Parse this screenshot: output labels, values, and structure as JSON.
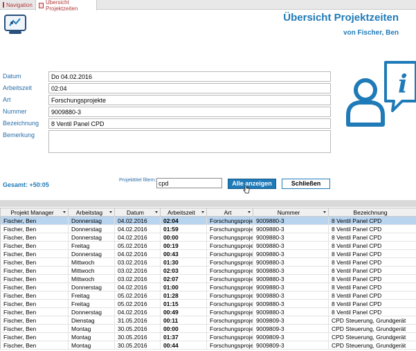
{
  "tabs": [
    {
      "label": "Navigation"
    },
    {
      "label": "Übersicht Projektzeiten"
    }
  ],
  "header": {
    "title": "Übersicht Projektzeiten",
    "subtitle": "von Fischer, Ben"
  },
  "form": {
    "datum_label": "Datum",
    "datum_value": "Do 04.02.2016",
    "arbeitszeit_label": "Arbeitszeit",
    "arbeitszeit_value": "02:04",
    "art_label": "Art",
    "art_value": "Forschungsprojekte",
    "nummer_label": "Nummer",
    "nummer_value": "9009880-3",
    "bezeichnung_label": "Bezeichnung",
    "bezeichnung_value": "8 Ventil Panel CPD",
    "bemerkung_label": "Bemerkung",
    "bemerkung_value": ""
  },
  "summary": {
    "gesamt": "Gesamt:  +50:05"
  },
  "filter": {
    "label": "Projekttitel filtern:",
    "value": "cpd"
  },
  "buttons": {
    "alle": "Alle anzeigen",
    "schliessen": "Schließen"
  },
  "table": {
    "columns": [
      "Projekt Manager",
      "Arbeitstag",
      "Datum",
      "Arbeitszeit",
      "Art",
      "Nummer",
      "Bezeichnung"
    ],
    "rows": [
      [
        "Fischer, Ben",
        "Donnerstag",
        "04.02.2016",
        "02:04",
        "Forschungsproje",
        "9009880-3",
        "8 Ventil Panel CPD"
      ],
      [
        "Fischer, Ben",
        "Donnerstag",
        "04.02.2016",
        "01:59",
        "Forschungsproje",
        "9009880-3",
        "8 Ventil Panel CPD"
      ],
      [
        "Fischer, Ben",
        "Donnerstag",
        "04.02.2016",
        "00:00",
        "Forschungsproje",
        "9009880-3",
        "8 Ventil Panel CPD"
      ],
      [
        "Fischer, Ben",
        "Freitag",
        "05.02.2016",
        "00:19",
        "Forschungsproje",
        "9009880-3",
        "8 Ventil Panel CPD"
      ],
      [
        "Fischer, Ben",
        "Donnerstag",
        "04.02.2016",
        "00:43",
        "Forschungsproje",
        "9009880-3",
        "8 Ventil Panel CPD"
      ],
      [
        "Fischer, Ben",
        "Mittwoch",
        "03.02.2016",
        "01:30",
        "Forschungsproje",
        "9009880-3",
        "8 Ventil Panel CPD"
      ],
      [
        "Fischer, Ben",
        "Mittwoch",
        "03.02.2016",
        "02:03",
        "Forschungsproje",
        "9009880-3",
        "8 Ventil Panel CPD"
      ],
      [
        "Fischer, Ben",
        "Mittwoch",
        "03.02.2016",
        "02:07",
        "Forschungsproje",
        "9009880-3",
        "8 Ventil Panel CPD"
      ],
      [
        "Fischer, Ben",
        "Donnerstag",
        "04.02.2016",
        "01:00",
        "Forschungsproje",
        "9009880-3",
        "8 Ventil Panel CPD"
      ],
      [
        "Fischer, Ben",
        "Freitag",
        "05.02.2016",
        "01:28",
        "Forschungsproje",
        "9009880-3",
        "8 Ventil Panel CPD"
      ],
      [
        "Fischer, Ben",
        "Freitag",
        "05.02.2016",
        "01:15",
        "Forschungsproje",
        "9009880-3",
        "8 Ventil Panel CPD"
      ],
      [
        "Fischer, Ben",
        "Donnerstag",
        "04.02.2016",
        "00:49",
        "Forschungsproje",
        "9009880-3",
        "8 Ventil Panel CPD"
      ],
      [
        "Fischer, Ben",
        "Dienstag",
        "31.05.2016",
        "00:11",
        "Forschungsproje",
        "9009809-3",
        "CPD Steuerung, Grundgerät"
      ],
      [
        "Fischer, Ben",
        "Montag",
        "30.05.2016",
        "00:00",
        "Forschungsproje",
        "9009809-3",
        "CPD Steuerung, Grundgerät"
      ],
      [
        "Fischer, Ben",
        "Montag",
        "30.05.2016",
        "01:37",
        "Forschungsproje",
        "9009809-3",
        "CPD Steuerung, Grundgerät"
      ],
      [
        "Fischer, Ben",
        "Montag",
        "30.05.2016",
        "00:44",
        "Forschungsproje",
        "9009809-3",
        "CPD Steuerung, Grundgerät"
      ]
    ]
  },
  "colors": {
    "accent": "#1f7ab8",
    "selected_row": "#b8d4ef",
    "tab_text": "#b33a3a"
  }
}
